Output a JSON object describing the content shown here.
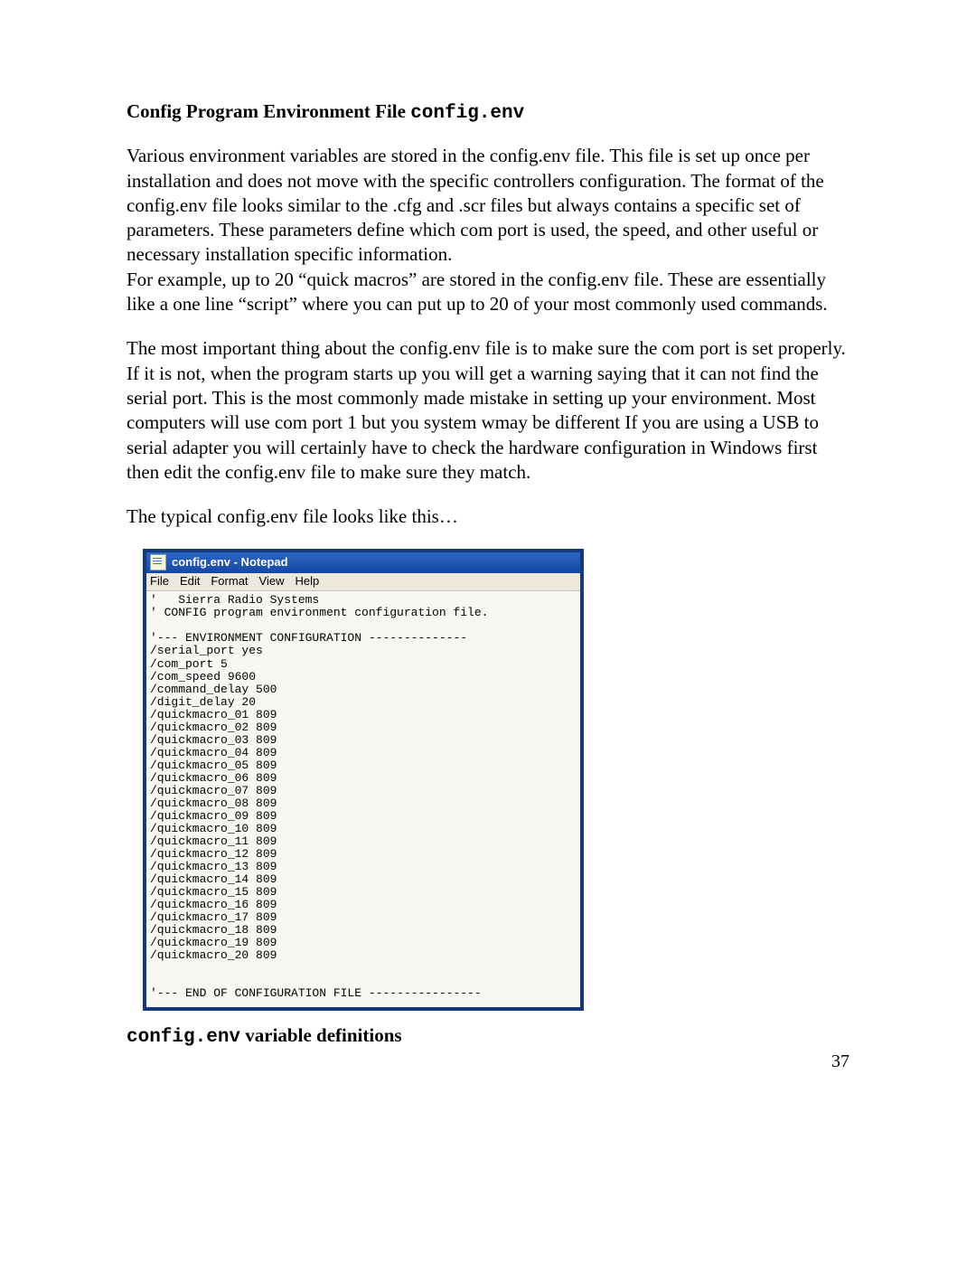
{
  "heading_prefix": "Config Program Environment File ",
  "heading_mono": "config.env",
  "para1": "Various environment variables are stored in the config.env file.  This file is set up once per installation and does not move with the specific controllers configuration.  The format of the config.env file looks similar to the .cfg and .scr files but always contains a specific set of parameters.  These parameters define which com port is used, the speed, and other useful or necessary installation specific information.\nFor example, up to 20 “quick macros” are stored in the config.env file.  These are essentially like a one line “script” where you can put up to 20 of your most commonly used commands.",
  "para2": "The most important thing about the config.env file is to make sure the com port is set properly.  If it is not, when the program starts up you will get a warning saying that it can not find the serial port.  This is the most commonly made mistake in setting up your environment.  Most computers will use com port 1 but you system wmay be different  If you are using a USB to serial adapter you will certainly have to check the hardware configuration in Windows first then edit the config.env file to make sure they match.",
  "para3": "The typical config.env file looks like this…",
  "notepad": {
    "title": "config.env - Notepad",
    "menu": [
      "File",
      "Edit",
      "Format",
      "View",
      "Help"
    ],
    "content": "'   Sierra Radio Systems\n' CONFIG program environment configuration file.\n\n'--- ENVIRONMENT CONFIGURATION --------------\n/serial_port yes\n/com_port 5\n/com_speed 9600\n/command_delay 500\n/digit_delay 20\n/quickmacro_01 809\n/quickmacro_02 809\n/quickmacro_03 809\n/quickmacro_04 809\n/quickmacro_05 809\n/quickmacro_06 809\n/quickmacro_07 809\n/quickmacro_08 809\n/quickmacro_09 809\n/quickmacro_10 809\n/quickmacro_11 809\n/quickmacro_12 809\n/quickmacro_13 809\n/quickmacro_14 809\n/quickmacro_15 809\n/quickmacro_16 809\n/quickmacro_17 809\n/quickmacro_18 809\n/quickmacro_19 809\n/quickmacro_20 809\n\n\n'--- END OF CONFIGURATION FILE ----------------"
  },
  "subheading_mono": "config.env",
  "subheading_suffix": " variable definitions",
  "page_number": "37"
}
